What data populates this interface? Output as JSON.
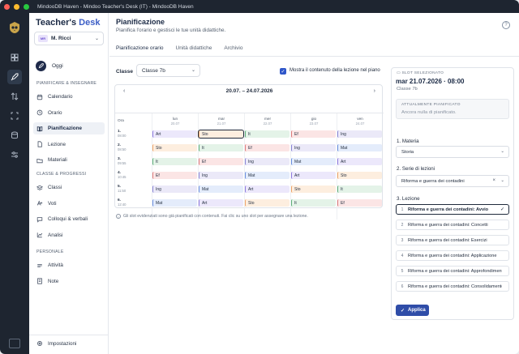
{
  "window": {
    "title": "MindooDB Haven - Mindoo Teacher's Desk (IT) - MindooDB Haven",
    "traffic_colors": [
      "#ff5f57",
      "#febc2e",
      "#28c840"
    ]
  },
  "brand": {
    "part1": "Teacher's ",
    "part2": "Desk"
  },
  "user": {
    "initials": "MR",
    "name": "M. Ricci"
  },
  "oggi": {
    "label": "Oggi"
  },
  "sidebar": {
    "sections": [
      {
        "title": "PIANIFICARE & INSEGNARE",
        "items": [
          {
            "label": "Calendario",
            "icon": "calendar-icon"
          },
          {
            "label": "Orario",
            "icon": "clock-icon"
          },
          {
            "label": "Pianificazione",
            "icon": "book-icon",
            "active": true
          },
          {
            "label": "Lezione",
            "icon": "doc-icon"
          },
          {
            "label": "Materiali",
            "icon": "folder-icon"
          }
        ]
      },
      {
        "title": "CLASSE & PROGRESSI",
        "items": [
          {
            "label": "Classi",
            "icon": "layers-icon"
          },
          {
            "label": "Voti",
            "icon": "grade-icon"
          },
          {
            "label": "Colloqui & verbali",
            "icon": "chat-icon"
          },
          {
            "label": "Analisi",
            "icon": "chart-icon"
          }
        ]
      },
      {
        "title": "PERSONALE",
        "items": [
          {
            "label": "Attività",
            "icon": "activity-icon"
          },
          {
            "label": "Note",
            "icon": "note-icon"
          }
        ]
      }
    ],
    "settings": "Impostazioni"
  },
  "page": {
    "title": "Pianificazione",
    "subtitle": "Pianifica l'orario e gestisci le tue unità didattiche.",
    "help": "?"
  },
  "tabs": [
    "Pianificazione orario",
    "Unità didattiche",
    "Archivio"
  ],
  "filter": {
    "classe_label": "Classe",
    "classe_value": "Classe 7b",
    "checkbox_label": "Mostra il contenuto della lezione nel piano"
  },
  "timetable": {
    "week": "20.07. – 24.07.2026",
    "ora_label": "Ora",
    "days": [
      {
        "name": "lun",
        "date": "20.07"
      },
      {
        "name": "mar",
        "date": "21.07"
      },
      {
        "name": "mer",
        "date": "22.07"
      },
      {
        "name": "gio",
        "date": "23.07"
      },
      {
        "name": "ven",
        "date": "24.07"
      }
    ],
    "periods": [
      {
        "n": "1.",
        "t": "08:00"
      },
      {
        "n": "2.",
        "t": "08:50"
      },
      {
        "n": "3.",
        "t": "09:55"
      },
      {
        "n": "4.",
        "t": "10:45"
      },
      {
        "n": "5.",
        "t": "11:50"
      },
      {
        "n": "6.",
        "t": "12:40"
      }
    ],
    "cells": [
      [
        "Art",
        "Sto",
        "It",
        "Ef",
        "Ing"
      ],
      [
        "Sto",
        "It",
        "Ef",
        "Ing",
        "Mat"
      ],
      [
        "It",
        "Ef",
        "Ing",
        "Mat",
        "Art"
      ],
      [
        "Ef",
        "Ing",
        "Mat",
        "Art",
        "Sto"
      ],
      [
        "Ing",
        "Mat",
        "Art",
        "Sto",
        "It"
      ],
      [
        "Mat",
        "Art",
        "Sto",
        "It",
        "Ef"
      ]
    ],
    "selected": {
      "row": 0,
      "col": 1
    },
    "hint": "Gli slot evidenziati sono già pianificati con contenuti. Fai clic su uno slot per assegnare una lezione.",
    "subject_colors": {
      "Art": {
        "bg": "#ece8fb",
        "bar": "#8f7be0"
      },
      "Sto": {
        "bg": "#fdeedf",
        "bar": "#f0a468"
      },
      "It": {
        "bg": "#e4f3e8",
        "bar": "#5fb07a"
      },
      "Ef": {
        "bg": "#fbe5e5",
        "bar": "#e07c7c"
      },
      "Ing": {
        "bg": "#ebe9f8",
        "bar": "#8a85d6"
      },
      "Mat": {
        "bg": "#e4ecfb",
        "bar": "#6a8fe0"
      }
    }
  },
  "panel": {
    "header": "SLOT SELEZIONATO",
    "date": "mar 21.07.2026 · 08:00",
    "class": "Classe 7b",
    "current_title": "ATTUALMENTE PIANIFICATO",
    "current_value": "Ancora nulla di pianificato.",
    "materia_label": "1. Materia",
    "materia_value": "Storia",
    "serie_label": "2. Serie di lezioni",
    "serie_value": "Riforma e guerra dei contadini",
    "lezione_label": "3. Lezione",
    "lessons": [
      {
        "n": "1",
        "title": "Riforma e guerra dei contadini: Avvio",
        "selected": true
      },
      {
        "n": "2",
        "title": "Riforma e guerra dei contadini: Concetti"
      },
      {
        "n": "3",
        "title": "Riforma e guerra dei contadini: Esercizi"
      },
      {
        "n": "4",
        "title": "Riforma e guerra dei contadini: Applicazione"
      },
      {
        "n": "5",
        "title": "Riforma e guerra dei contadini: Approfondimento"
      },
      {
        "n": "6",
        "title": "Riforma e guerra dei contadini: Consolidamento"
      }
    ],
    "apply": "Applica"
  }
}
